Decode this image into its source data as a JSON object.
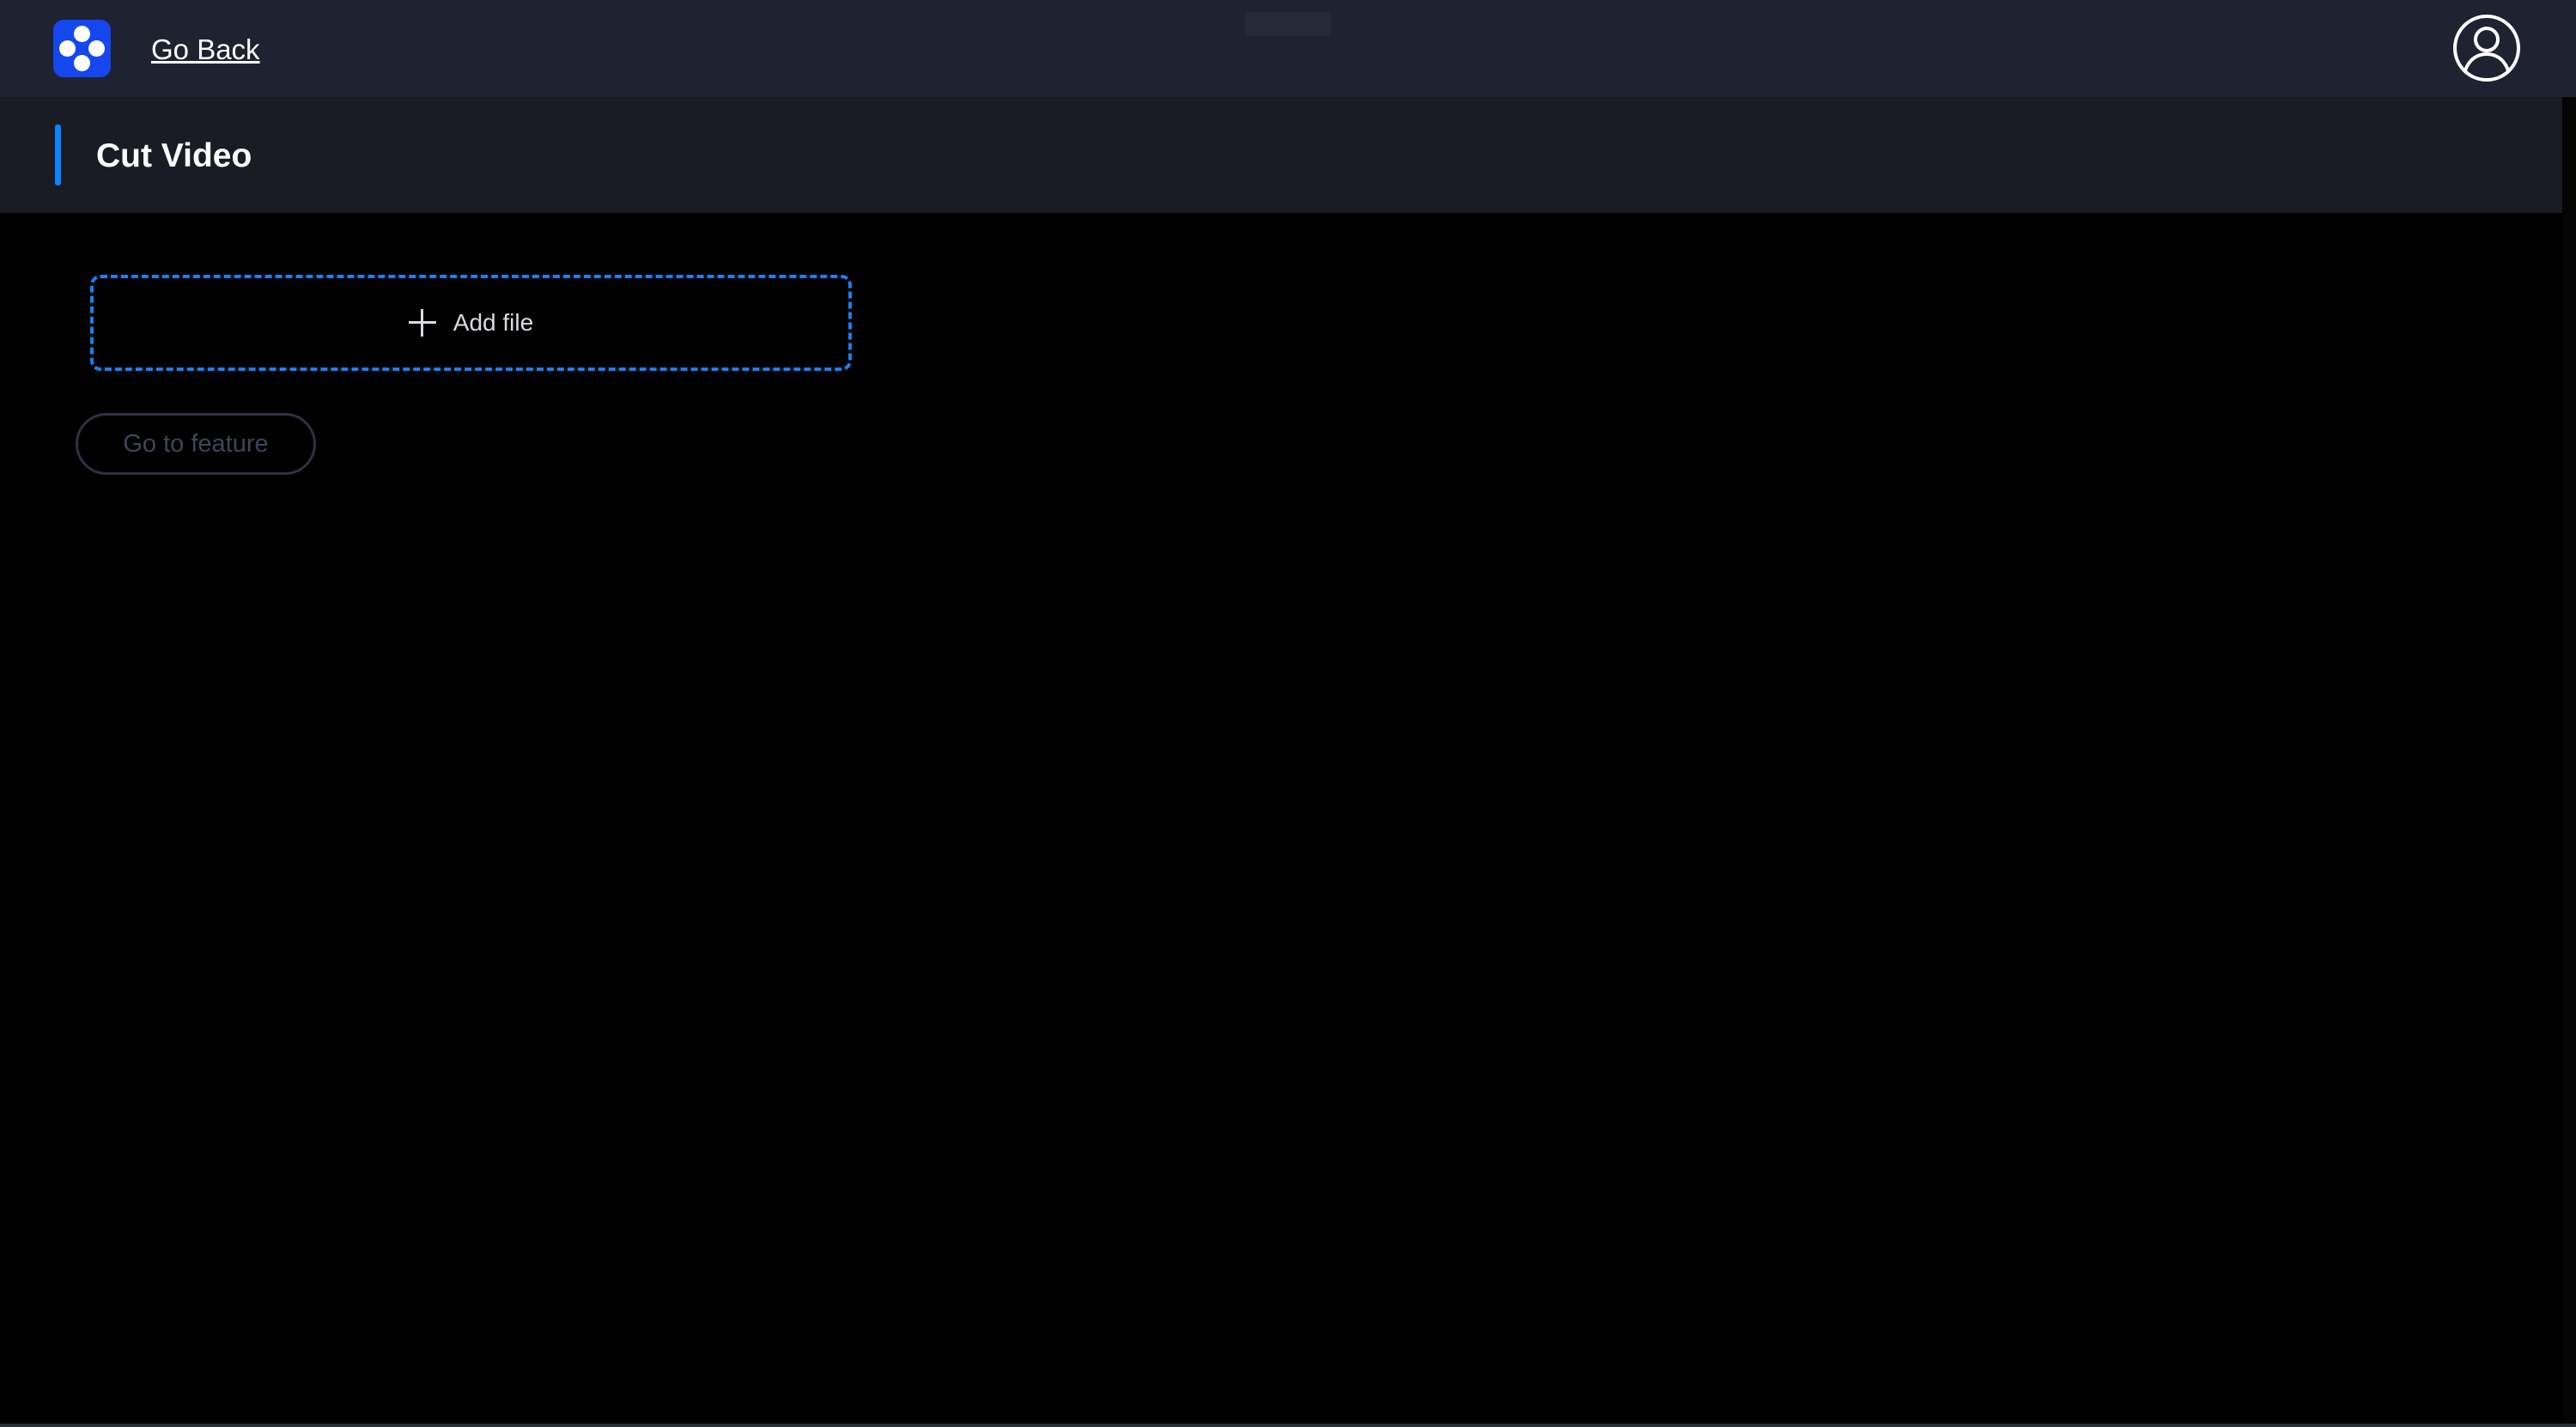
{
  "header": {
    "logo_icon": "app-logo-dots-icon",
    "go_back_label": "Go Back",
    "avatar_icon": "user-avatar-icon"
  },
  "page": {
    "title": "Cut Video"
  },
  "upload": {
    "add_file_label": "Add file",
    "add_icon": "plus-icon"
  },
  "actions": {
    "go_to_feature_label": "Go to feature",
    "go_to_feature_enabled": false
  },
  "colors": {
    "accent": "#0a84ff",
    "logo_bg": "#1547ef",
    "topbar_bg": "#1f2230",
    "subheader_bg": "#1a1c25",
    "page_bg": "#000000"
  }
}
